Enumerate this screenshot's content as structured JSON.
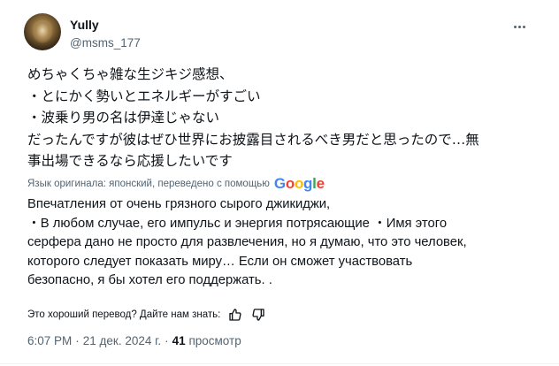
{
  "header": {
    "cut_text": "",
    "display_name": "Yully",
    "handle": "@msms_177"
  },
  "post": {
    "original_lines": [
      "めちゃくちゃ雑な生ジキジ感想、",
      "・とにかく勢いとエネルギーがすごい",
      "・波乗り男の名は伊達じゃない",
      "だったんですが彼はぜひ世界にお披露目されるべき男だと思ったので…無",
      "事出場できるなら応援したいです"
    ],
    "translated_by_label": "Язык оригинала: японский, переведено с помощью",
    "translator_logo": [
      "G",
      "o",
      "o",
      "g",
      "l",
      "e"
    ],
    "translation_lines": [
      "Впечатления от очень грязного сырого джикиджи,",
      "・В любом случае, его импульс и энергия потрясающие ・Имя этого",
      "серфера дано не просто для развлечения, но я думаю, что это человек,",
      "которого следует показать миру… Если он сможет участвовать",
      "безопасно, я бы хотел его поддержать. ."
    ],
    "feedback_prompt": "Это хороший перевод? Дайте нам знать:",
    "time": "6:07 PM",
    "date": "21 дек. 2024 г.",
    "views_count": "41",
    "views_label": "просмотр",
    "separator": "·"
  },
  "icons": {
    "more": "more-horizontal-icon",
    "thumb_up": "thumbs-up-icon",
    "thumb_down": "thumbs-down-icon"
  },
  "colors": {
    "text_primary": "#0f1419",
    "text_secondary": "#536471"
  }
}
